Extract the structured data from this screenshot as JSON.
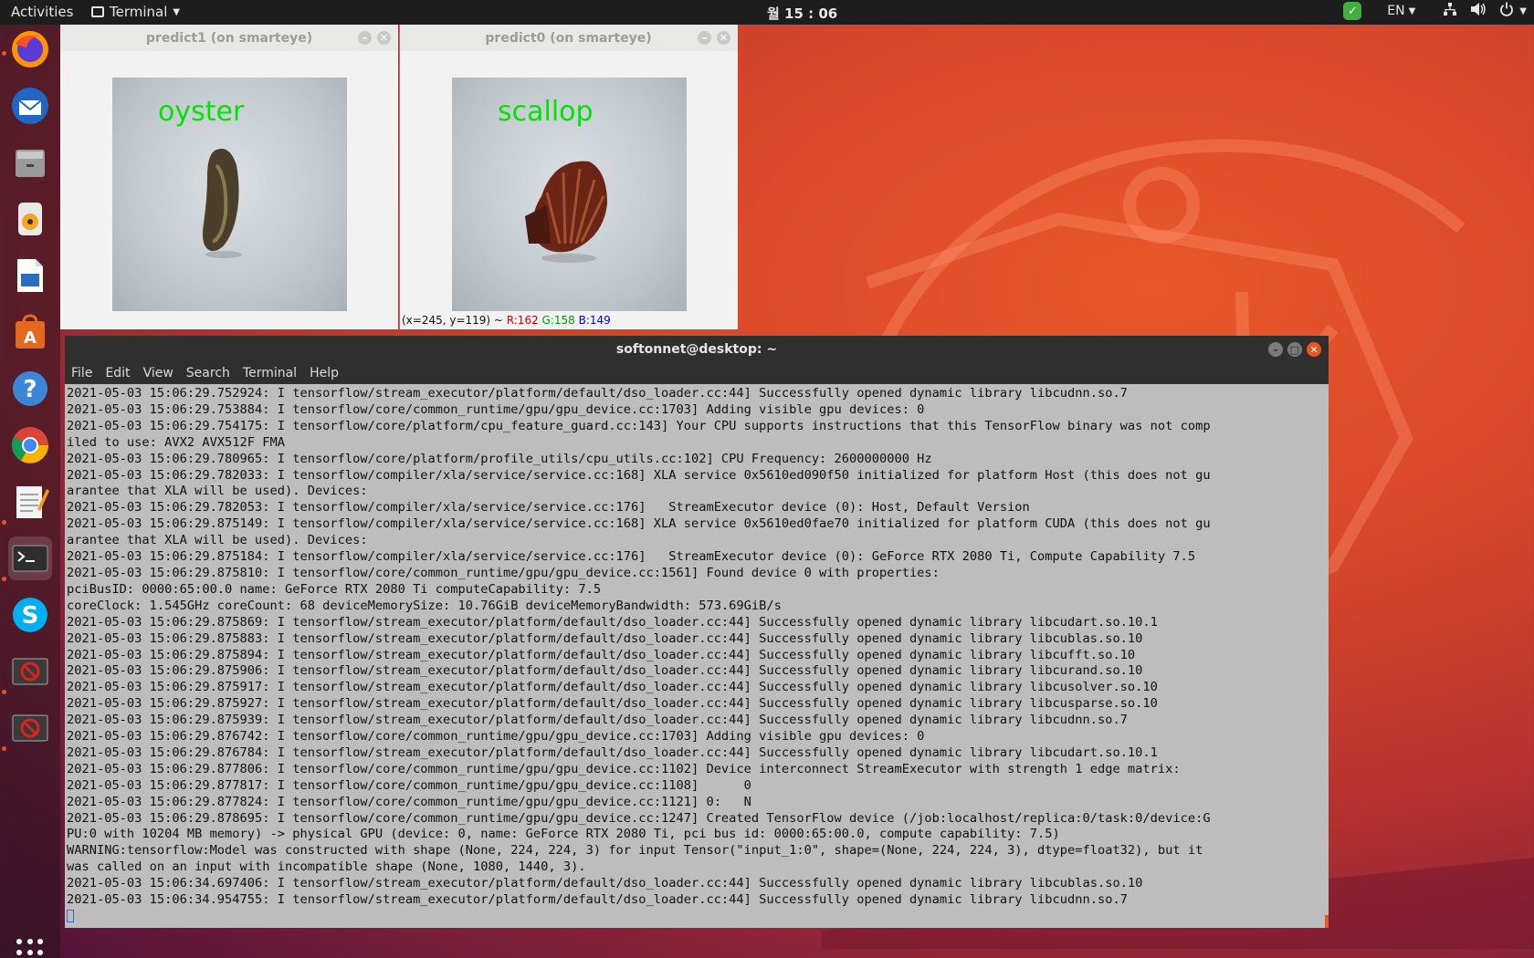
{
  "topbar": {
    "activities": "Activities",
    "app_name": "Terminal",
    "clock": "월 15 : 06",
    "language": "EN"
  },
  "dock": {
    "items": [
      "firefox-icon",
      "thunderbird-icon",
      "files-icon",
      "rhythmbox-icon",
      "libreoffice-writer-icon",
      "software-center-icon",
      "help-icon",
      "chrome-icon",
      "text-editor-icon",
      "terminal-icon",
      "skype-icon",
      "blocked-app-icon",
      "blocked-app-icon"
    ]
  },
  "predict1": {
    "title": "predict1 (on smarteye)",
    "label": "oyster"
  },
  "predict0": {
    "title": "predict0 (on smarteye)",
    "label": "scallop",
    "status_prefix": "(x=245, y=119) ~ ",
    "status_r": "R:162",
    "status_g": "G:158",
    "status_b": "B:149"
  },
  "terminal": {
    "title": "softonnet@desktop: ~",
    "menu": [
      "File",
      "Edit",
      "View",
      "Search",
      "Terminal",
      "Help"
    ],
    "lines": [
      "2021-05-03 15:06:29.752924: I tensorflow/stream_executor/platform/default/dso_loader.cc:44] Successfully opened dynamic library libcudnn.so.7",
      "2021-05-03 15:06:29.753884: I tensorflow/core/common_runtime/gpu/gpu_device.cc:1703] Adding visible gpu devices: 0",
      "2021-05-03 15:06:29.754175: I tensorflow/core/platform/cpu_feature_guard.cc:143] Your CPU supports instructions that this TensorFlow binary was not comp",
      "iled to use: AVX2 AVX512F FMA",
      "2021-05-03 15:06:29.780965: I tensorflow/core/platform/profile_utils/cpu_utils.cc:102] CPU Frequency: 2600000000 Hz",
      "2021-05-03 15:06:29.782033: I tensorflow/compiler/xla/service/service.cc:168] XLA service 0x5610ed090f50 initialized for platform Host (this does not gu",
      "arantee that XLA will be used). Devices:",
      "2021-05-03 15:06:29.782053: I tensorflow/compiler/xla/service/service.cc:176]   StreamExecutor device (0): Host, Default Version",
      "2021-05-03 15:06:29.875149: I tensorflow/compiler/xla/service/service.cc:168] XLA service 0x5610ed0fae70 initialized for platform CUDA (this does not gu",
      "arantee that XLA will be used). Devices:",
      "2021-05-03 15:06:29.875184: I tensorflow/compiler/xla/service/service.cc:176]   StreamExecutor device (0): GeForce RTX 2080 Ti, Compute Capability 7.5",
      "2021-05-03 15:06:29.875810: I tensorflow/core/common_runtime/gpu/gpu_device.cc:1561] Found device 0 with properties:",
      "pciBusID: 0000:65:00.0 name: GeForce RTX 2080 Ti computeCapability: 7.5",
      "coreClock: 1.545GHz coreCount: 68 deviceMemorySize: 10.76GiB deviceMemoryBandwidth: 573.69GiB/s",
      "2021-05-03 15:06:29.875869: I tensorflow/stream_executor/platform/default/dso_loader.cc:44] Successfully opened dynamic library libcudart.so.10.1",
      "2021-05-03 15:06:29.875883: I tensorflow/stream_executor/platform/default/dso_loader.cc:44] Successfully opened dynamic library libcublas.so.10",
      "2021-05-03 15:06:29.875894: I tensorflow/stream_executor/platform/default/dso_loader.cc:44] Successfully opened dynamic library libcufft.so.10",
      "2021-05-03 15:06:29.875906: I tensorflow/stream_executor/platform/default/dso_loader.cc:44] Successfully opened dynamic library libcurand.so.10",
      "2021-05-03 15:06:29.875917: I tensorflow/stream_executor/platform/default/dso_loader.cc:44] Successfully opened dynamic library libcusolver.so.10",
      "2021-05-03 15:06:29.875927: I tensorflow/stream_executor/platform/default/dso_loader.cc:44] Successfully opened dynamic library libcusparse.so.10",
      "2021-05-03 15:06:29.875939: I tensorflow/stream_executor/platform/default/dso_loader.cc:44] Successfully opened dynamic library libcudnn.so.7",
      "2021-05-03 15:06:29.876742: I tensorflow/core/common_runtime/gpu/gpu_device.cc:1703] Adding visible gpu devices: 0",
      "2021-05-03 15:06:29.876784: I tensorflow/stream_executor/platform/default/dso_loader.cc:44] Successfully opened dynamic library libcudart.so.10.1",
      "2021-05-03 15:06:29.877806: I tensorflow/core/common_runtime/gpu/gpu_device.cc:1102] Device interconnect StreamExecutor with strength 1 edge matrix:",
      "2021-05-03 15:06:29.877817: I tensorflow/core/common_runtime/gpu/gpu_device.cc:1108]      0",
      "2021-05-03 15:06:29.877824: I tensorflow/core/common_runtime/gpu/gpu_device.cc:1121] 0:   N",
      "2021-05-03 15:06:29.878695: I tensorflow/core/common_runtime/gpu/gpu_device.cc:1247] Created TensorFlow device (/job:localhost/replica:0/task:0/device:G",
      "PU:0 with 10204 MB memory) -> physical GPU (device: 0, name: GeForce RTX 2080 Ti, pci bus id: 0000:65:00.0, compute capability: 7.5)",
      "WARNING:tensorflow:Model was constructed with shape (None, 224, 224, 3) for input Tensor(\"input_1:0\", shape=(None, 224, 224, 3), dtype=float32), but it",
      "was called on an input with incompatible shape (None, 1080, 1440, 3).",
      "2021-05-03 15:06:34.697406: I tensorflow/stream_executor/platform/default/dso_loader.cc:44] Successfully opened dynamic library libcublas.so.10",
      "2021-05-03 15:06:34.954755: I tensorflow/stream_executor/platform/default/dso_loader.cc:44] Successfully opened dynamic library libcudnn.so.7"
    ]
  },
  "colors": {
    "accent": "#e95420",
    "prediction_label": "#00e400"
  }
}
